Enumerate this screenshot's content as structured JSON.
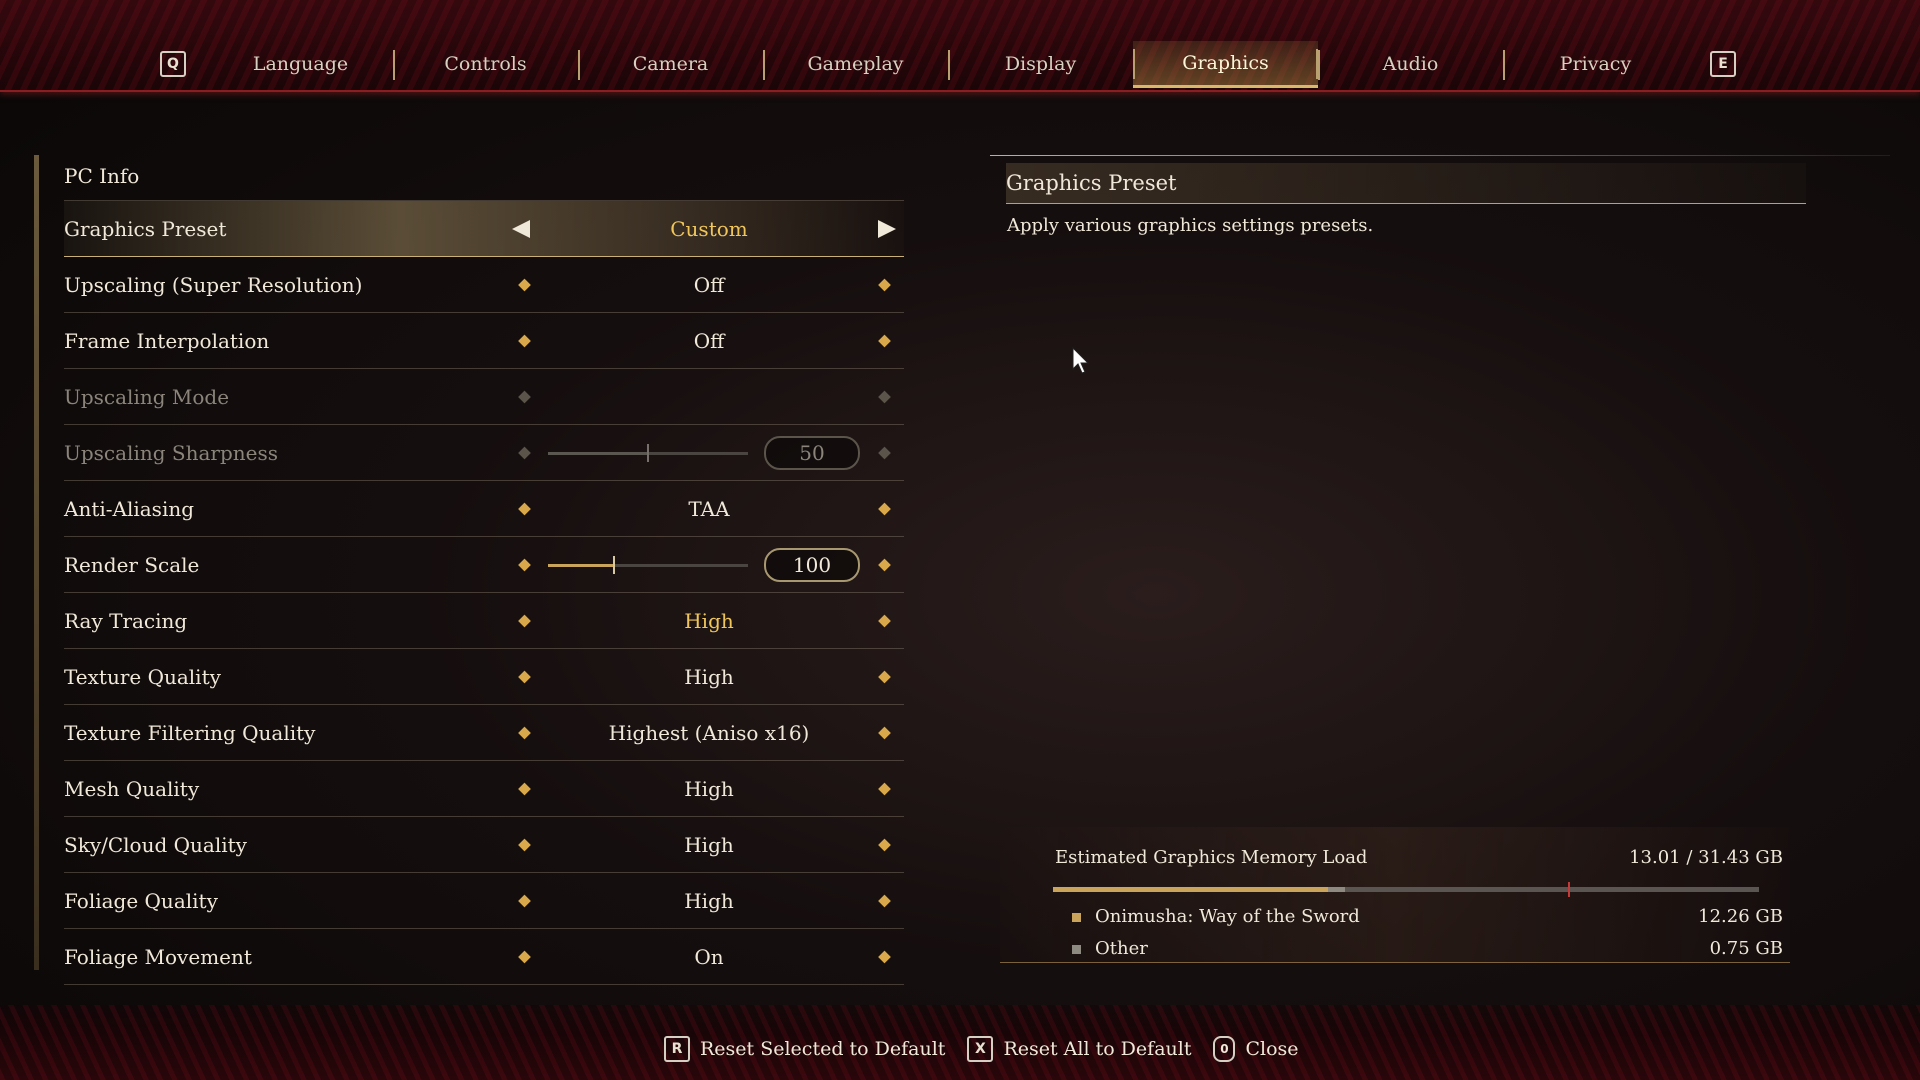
{
  "tabs": {
    "prev_key": "Q",
    "next_key": "E",
    "items": [
      "Language",
      "Controls",
      "Camera",
      "Gameplay",
      "Display",
      "Graphics",
      "Audio",
      "Privacy"
    ],
    "active": "Graphics"
  },
  "settings": {
    "header": "PC Info",
    "rows": [
      {
        "label": "Graphics Preset",
        "value": "Custom"
      },
      {
        "label": "Upscaling (Super Resolution)",
        "value": "Off"
      },
      {
        "label": "Frame Interpolation",
        "value": "Off"
      },
      {
        "label": "Upscaling Mode",
        "value": ""
      },
      {
        "label": "Upscaling Sharpness",
        "value": "50",
        "slider_fraction": 0.5
      },
      {
        "label": "Anti-Aliasing",
        "value": "TAA"
      },
      {
        "label": "Render Scale",
        "value": "100",
        "slider_fraction": 0.33
      },
      {
        "label": "Ray Tracing",
        "value": "High"
      },
      {
        "label": "Texture Quality",
        "value": "High"
      },
      {
        "label": "Texture Filtering Quality",
        "value": "Highest (Aniso x16)"
      },
      {
        "label": "Mesh Quality",
        "value": "High"
      },
      {
        "label": "Sky/Cloud Quality",
        "value": "High"
      },
      {
        "label": "Foliage Quality",
        "value": "High"
      },
      {
        "label": "Foliage Movement",
        "value": "On"
      }
    ]
  },
  "description": {
    "title": "Graphics Preset",
    "text": "Apply various graphics settings presets."
  },
  "memory": {
    "title": "Estimated Graphics Memory Load",
    "total": "13.01 / 31.43 GB",
    "game_fraction": 0.39,
    "other_fraction": 0.024,
    "limit_fraction": 0.73,
    "items": [
      {
        "name": "Onimusha: Way of the Sword",
        "value": "12.26 GB",
        "color": "#c9a45a"
      },
      {
        "name": "Other",
        "value": "0.75 GB",
        "color": "#8e8a82"
      }
    ]
  },
  "hints": [
    {
      "key": "R",
      "label": "Reset Selected to Default"
    },
    {
      "key": "X",
      "label": "Reset All to Default"
    },
    {
      "key": "0",
      "label": "Close"
    }
  ],
  "colors": {
    "accent": "#c9a45a",
    "highlight_value": "#f0c65a",
    "tabbar": "#3a0a10"
  }
}
